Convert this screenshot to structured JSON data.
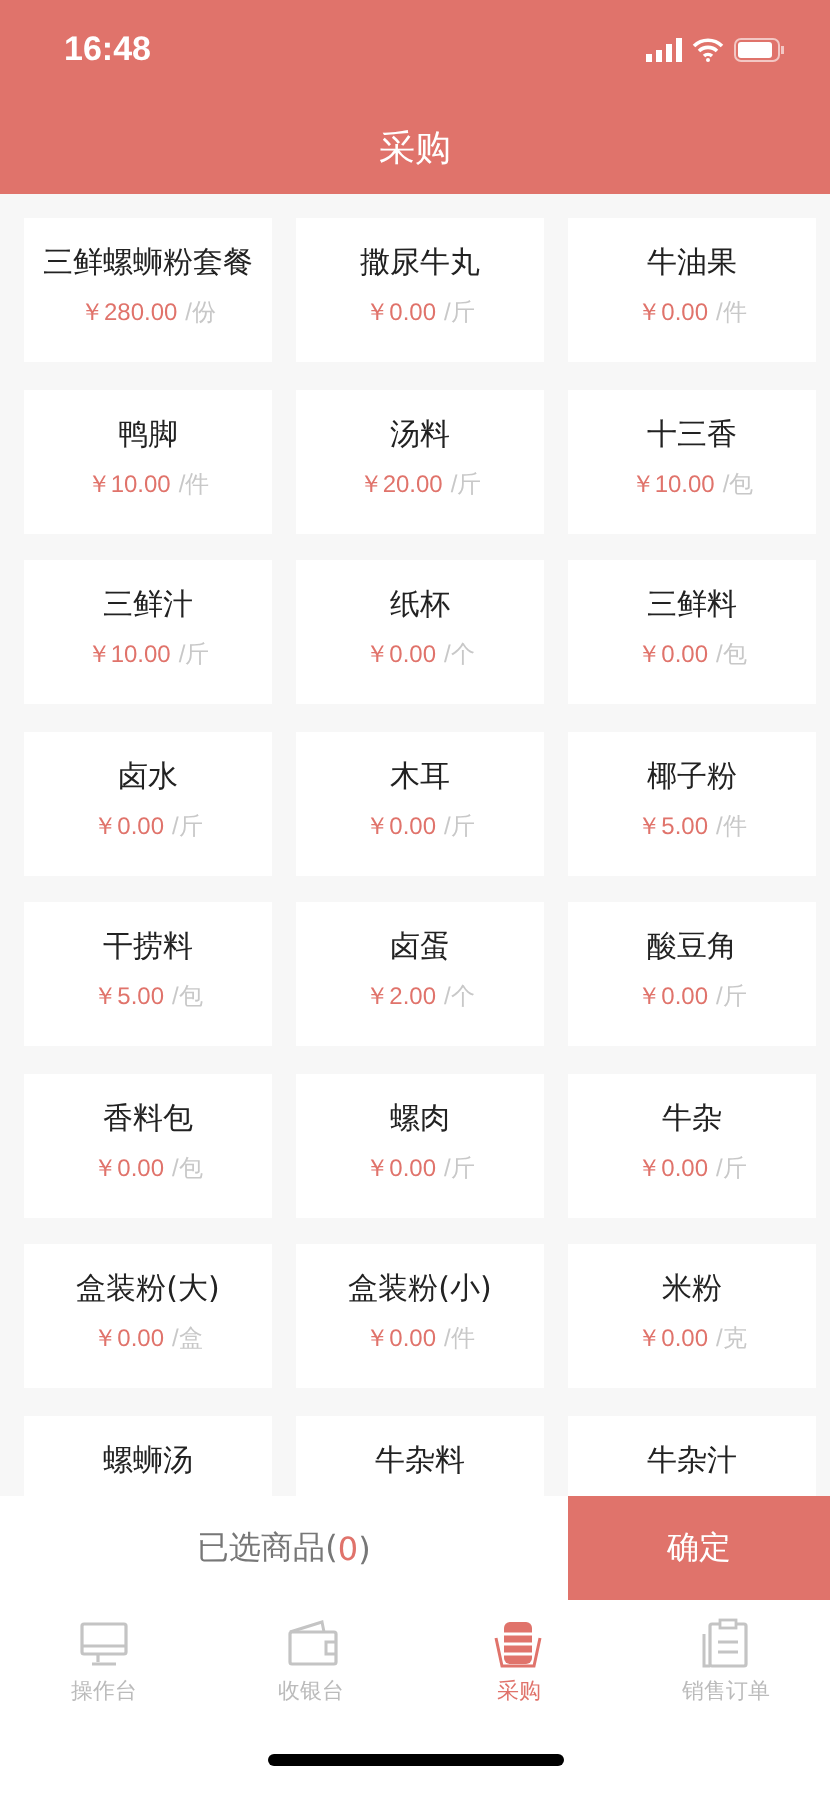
{
  "status_bar": {
    "time": "16:48"
  },
  "header": {
    "title": "采购"
  },
  "products": [
    {
      "name": "三鲜螺蛳粉套餐",
      "price": "￥280.00",
      "unit": "/份"
    },
    {
      "name": "撒尿牛丸",
      "price": "￥0.00",
      "unit": "/斤"
    },
    {
      "name": "牛油果",
      "price": "￥0.00",
      "unit": "/件"
    },
    {
      "name": "鸭脚",
      "price": "￥10.00",
      "unit": "/件"
    },
    {
      "name": "汤料",
      "price": "￥20.00",
      "unit": "/斤"
    },
    {
      "name": "十三香",
      "price": "￥10.00",
      "unit": "/包"
    },
    {
      "name": "三鲜汁",
      "price": "￥10.00",
      "unit": "/斤"
    },
    {
      "name": "纸杯",
      "price": "￥0.00",
      "unit": "/个"
    },
    {
      "name": "三鲜料",
      "price": "￥0.00",
      "unit": "/包"
    },
    {
      "name": "卤水",
      "price": "￥0.00",
      "unit": "/斤"
    },
    {
      "name": "木耳",
      "price": "￥0.00",
      "unit": "/斤"
    },
    {
      "name": "椰子粉",
      "price": "￥5.00",
      "unit": "/件"
    },
    {
      "name": "干捞料",
      "price": "￥5.00",
      "unit": "/包"
    },
    {
      "name": "卤蛋",
      "price": "￥2.00",
      "unit": "/个"
    },
    {
      "name": "酸豆角",
      "price": "￥0.00",
      "unit": "/斤"
    },
    {
      "name": "香料包",
      "price": "￥0.00",
      "unit": "/包"
    },
    {
      "name": "螺肉",
      "price": "￥0.00",
      "unit": "/斤"
    },
    {
      "name": "牛杂",
      "price": "￥0.00",
      "unit": "/斤"
    },
    {
      "name": "盒装粉(大)",
      "price": "￥0.00",
      "unit": "/盒"
    },
    {
      "name": "盒装粉(小)",
      "price": "￥0.00",
      "unit": "/件"
    },
    {
      "name": "米粉",
      "price": "￥0.00",
      "unit": "/克"
    },
    {
      "name": "螺蛳汤"
    },
    {
      "name": "牛杂料"
    },
    {
      "name": "牛杂汁"
    }
  ],
  "selection_bar": {
    "text_before": "已选商品(",
    "count": "0",
    "text_after": ")",
    "confirm_button": "确定"
  },
  "tab_bar": [
    {
      "label": "操作台",
      "selected": false
    },
    {
      "label": "收银台",
      "selected": false
    },
    {
      "label": "采购",
      "selected": true
    },
    {
      "label": "销售订单",
      "selected": false
    }
  ]
}
